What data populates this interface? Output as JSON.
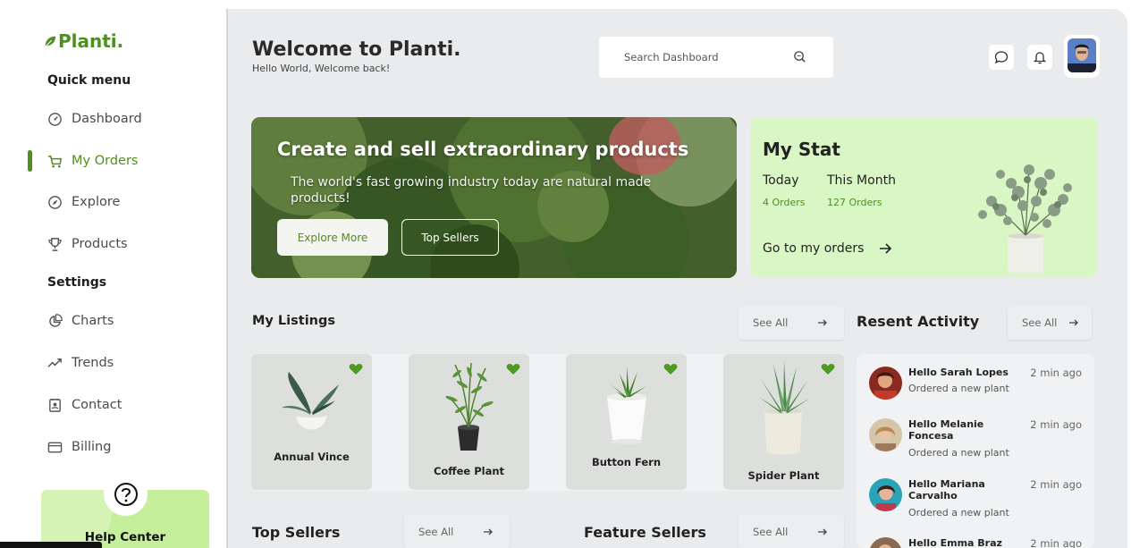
{
  "brand": {
    "name": "Planti."
  },
  "sidebar": {
    "quick_menu_title": "Quick menu",
    "settings_title": "Settings",
    "quick_items": [
      {
        "label": "Dashboard",
        "icon": "gauge-icon"
      },
      {
        "label": "My Orders",
        "icon": "cart-icon",
        "active": true
      },
      {
        "label": "Explore",
        "icon": "compass-icon"
      },
      {
        "label": "Products",
        "icon": "trophy-icon"
      }
    ],
    "settings_items": [
      {
        "label": "Charts",
        "icon": "pie-chart-icon"
      },
      {
        "label": "Trends",
        "icon": "trend-icon"
      },
      {
        "label": "Contact",
        "icon": "contact-icon"
      },
      {
        "label": "Billing",
        "icon": "card-icon"
      }
    ],
    "help_label": "Help Center"
  },
  "header": {
    "title": "Welcome to Planti.",
    "subtitle": "Hello World, Welcome back!",
    "search_placeholder": "Search Dashboard"
  },
  "hero": {
    "title": "Create and sell extraordinary products",
    "text": "The world's fast growing industry today are natural made products!",
    "primary_button": "Explore More",
    "secondary_button": "Top Sellers"
  },
  "stat": {
    "title": "My Stat",
    "today_label": "Today",
    "today_value": "4 Orders",
    "month_label": "This Month",
    "month_value": "127 Orders",
    "link_label": "Go to my orders"
  },
  "listings": {
    "title": "My Listings",
    "see_all": "See All",
    "items": [
      {
        "name": "Annual Vince"
      },
      {
        "name": "Coffee Plant"
      },
      {
        "name": "Button Fern"
      },
      {
        "name": "Spider Plant"
      }
    ]
  },
  "activity": {
    "title": "Resent Activity",
    "see_all": "See All",
    "items": [
      {
        "name": "Hello Sarah Lopes",
        "action": "Ordered a new plant",
        "time": "2 min ago"
      },
      {
        "name": "Hello Melanie Foncesa",
        "action": "Ordered a new plant",
        "time": "2 min ago"
      },
      {
        "name": "Hello Mariana Carvalho",
        "action": "Ordered a new plant",
        "time": "2 min ago"
      },
      {
        "name": "Hello Emma Braz",
        "action": "",
        "time": "2 min ago"
      }
    ]
  },
  "top_sellers": {
    "title": "Top Sellers",
    "see_all": "See All"
  },
  "feature_sellers": {
    "title": "Feature Sellers",
    "see_all": "See All"
  },
  "colors": {
    "accent": "#4f8f1f",
    "stat_bg": "#d9f7c4",
    "help_bg": "#c6ef9c",
    "main_bg": "#e9ebec"
  }
}
